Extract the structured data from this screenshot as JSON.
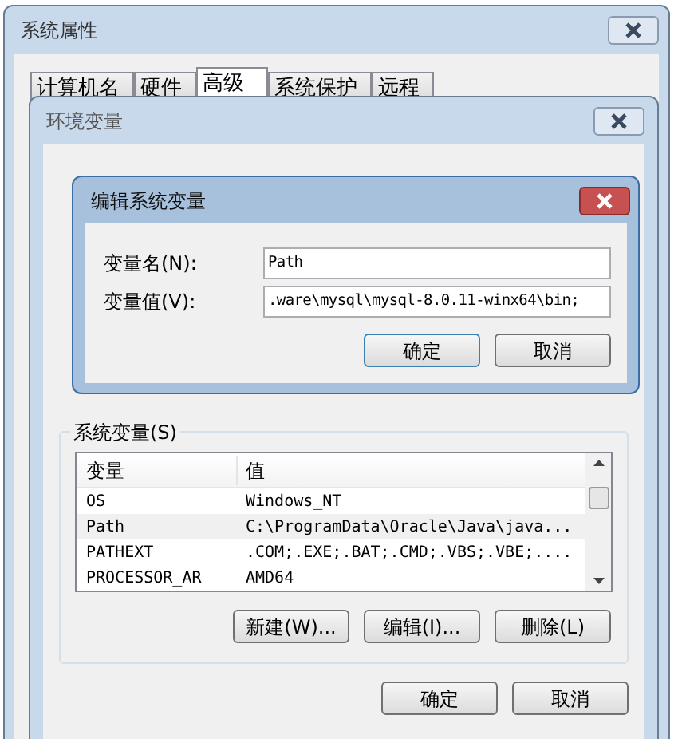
{
  "system_properties": {
    "title": "系统属性",
    "tabs": [
      {
        "label": "计算机名",
        "selected": false
      },
      {
        "label": "硬件",
        "selected": false
      },
      {
        "label": "高级",
        "selected": true
      },
      {
        "label": "系统保护",
        "selected": false
      },
      {
        "label": "远程",
        "selected": false
      }
    ]
  },
  "environment_variables": {
    "title": "环境变量",
    "system_variables": {
      "label": "系统变量(S)",
      "columns": [
        "变量",
        "值"
      ],
      "rows": [
        {
          "cells": [
            "OS",
            "Windows_NT"
          ],
          "selected": false
        },
        {
          "cells": [
            "Path",
            "C:\\ProgramData\\Oracle\\Java\\java..."
          ],
          "selected": true
        },
        {
          "cells": [
            "PATHEXT",
            ".COM;.EXE;.BAT;.CMD;.VBS;.VBE;...."
          ],
          "selected": false
        },
        {
          "cells": [
            "PROCESSOR_AR",
            "AMD64"
          ],
          "selected": false
        }
      ],
      "buttons": [
        "新建(W)...",
        "编辑(I)...",
        "删除(L)"
      ]
    },
    "buttons": [
      "确定",
      "取消"
    ]
  },
  "edit_dialog": {
    "title": "编辑系统变量",
    "fields": [
      {
        "label": "变量名(N):",
        "value": "Path"
      },
      {
        "label": "变量值(V):",
        "value": ".ware\\mysql\\mysql-8.0.11-winx64\\bin;"
      }
    ],
    "buttons": [
      {
        "label": "确定",
        "default": true
      },
      {
        "label": "取消",
        "default": false
      }
    ]
  }
}
